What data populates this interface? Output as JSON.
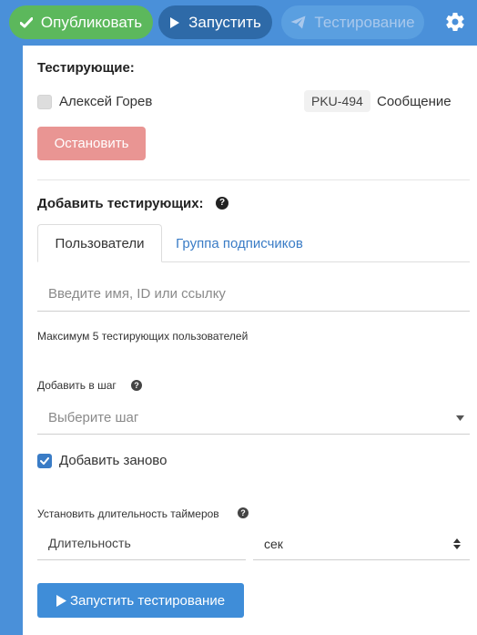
{
  "toolbar": {
    "publish_label": "Опубликовать",
    "run_label": "Запустить",
    "test_label": "Тестирование"
  },
  "testers": {
    "title": "Тестирующие:",
    "items": [
      {
        "name": "Алексей Горев",
        "code": "PKU-494",
        "link_label": "Сообщение",
        "checked": false
      }
    ],
    "stop_label": "Остановить"
  },
  "add_testers": {
    "title": "Добавить тестирующих:",
    "tabs": [
      {
        "label": "Пользователи",
        "active": true
      },
      {
        "label": "Группа подписчиков",
        "active": false
      }
    ],
    "search_placeholder": "Введите имя, ID или ссылку",
    "max_note": "Максимум 5 тестирующих пользователей",
    "step_label": "Добавить в шаг",
    "step_placeholder": "Выберите шаг",
    "readd_label": "Добавить заново",
    "readd_checked": true,
    "timer_label": "Установить длительность таймеров",
    "duration_placeholder": "Длительность",
    "unit_value": "сек",
    "start_label": "Запустить тестирование"
  },
  "colors": {
    "toolbar_bg": "#4a90d9",
    "publish_green": "#5cb85c",
    "stop_red": "#e99593",
    "primary_blue": "#3f8dd8"
  }
}
